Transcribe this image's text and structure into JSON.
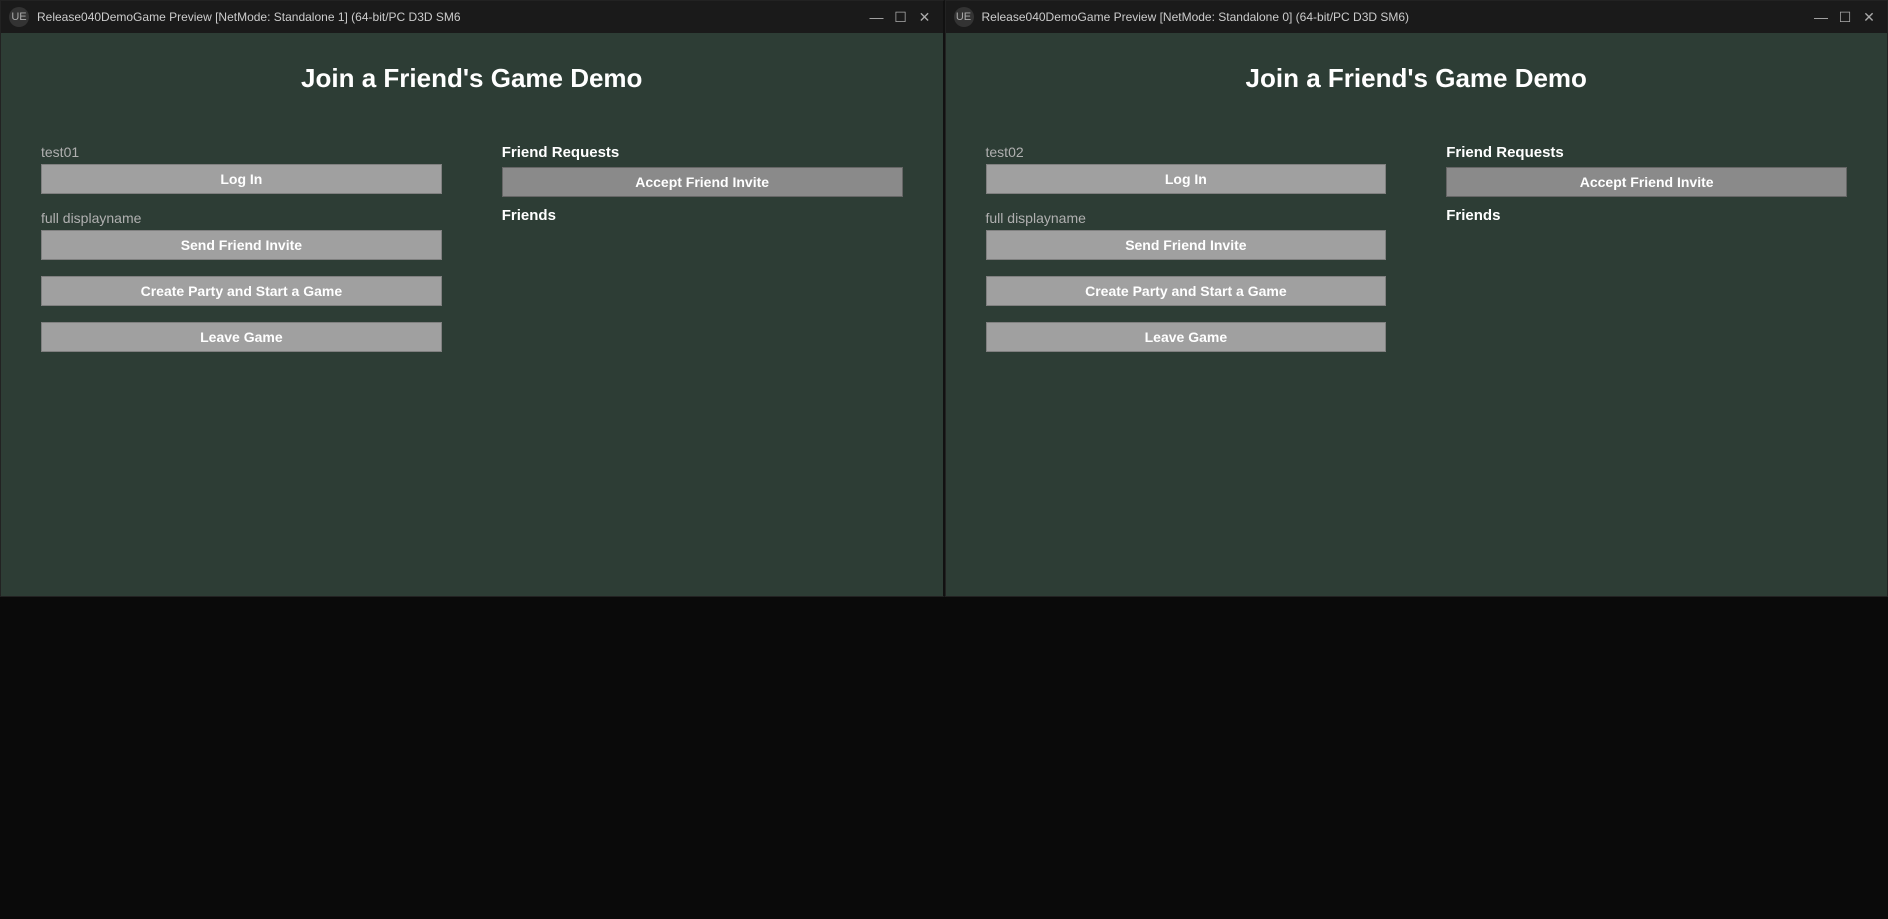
{
  "windows": [
    {
      "id": "window-left",
      "titlebar": {
        "title": "Release040DemoGame Preview [NetMode: Standalone 1]  (64-bit/PC D3D SM6",
        "logo": "UE"
      },
      "content": {
        "game_title": "Join a Friend's Game Demo",
        "left_panel": {
          "username_label": "test01",
          "login_button": "Log In",
          "friend_invite_label": "full displayname",
          "send_invite_button": "Send Friend Invite",
          "create_party_button": "Create Party and Start a Game",
          "leave_game_button": "Leave Game"
        },
        "right_panel": {
          "friend_requests_label": "Friend Requests",
          "accept_invite_button": "Accept Friend Invite",
          "friends_label": "Friends"
        }
      }
    },
    {
      "id": "window-right",
      "titlebar": {
        "title": "Release040DemoGame Preview [NetMode: Standalone 0]  (64-bit/PC D3D SM6)",
        "logo": "UE"
      },
      "content": {
        "game_title": "Join a Friend's Game Demo",
        "left_panel": {
          "username_label": "test02",
          "login_button": "Log In",
          "friend_invite_label": "full displayname",
          "send_invite_button": "Send Friend Invite",
          "create_party_button": "Create Party and Start a Game",
          "leave_game_button": "Leave Game"
        },
        "right_panel": {
          "friend_requests_label": "Friend Requests",
          "accept_invite_button": "Accept Friend Invite",
          "friends_label": "Friends"
        }
      }
    }
  ],
  "titlebar_controls": {
    "minimize": "—",
    "maximize": "☐",
    "close": "✕"
  }
}
